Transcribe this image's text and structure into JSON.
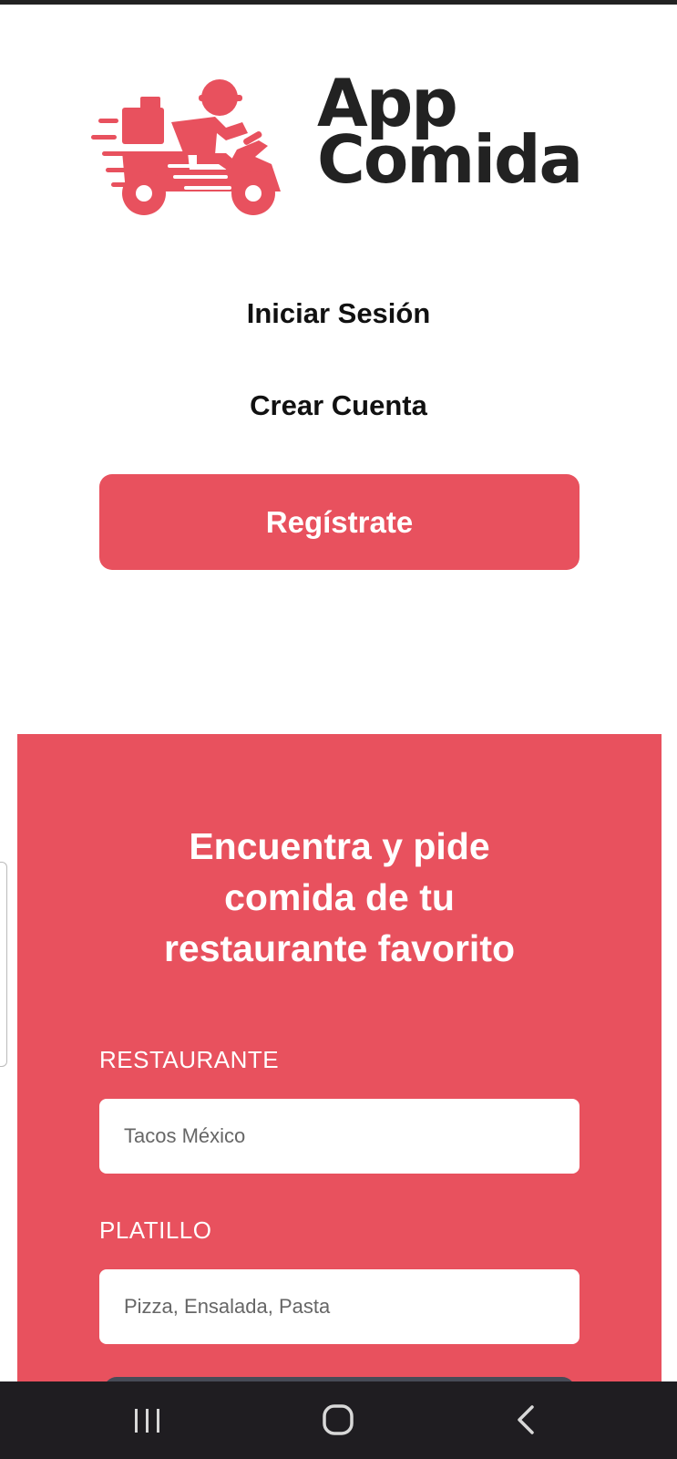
{
  "brand": {
    "name_line1": "App",
    "name_line2": "Comida",
    "logo_icon": "delivery-scooter-icon",
    "accent_color": "#e8515e"
  },
  "nav": {
    "login_label": "Iniciar Sesión",
    "create_account_label": "Crear Cuenta",
    "register_label": "Regístrate"
  },
  "search": {
    "heading_line1": "Encuentra y pide",
    "heading_line2": "comida de tu",
    "heading_line3": "restaurante favorito",
    "restaurant_label": "RESTAURANTE",
    "restaurant_placeholder": "Tacos México",
    "dish_label": "PLATILLO",
    "dish_placeholder": "Pizza, Ensalada, Pasta"
  },
  "system_nav": {
    "recent_icon": "recent-apps-icon",
    "home_icon": "home-icon",
    "back_icon": "back-icon",
    "bar_color": "#1f1d21"
  }
}
